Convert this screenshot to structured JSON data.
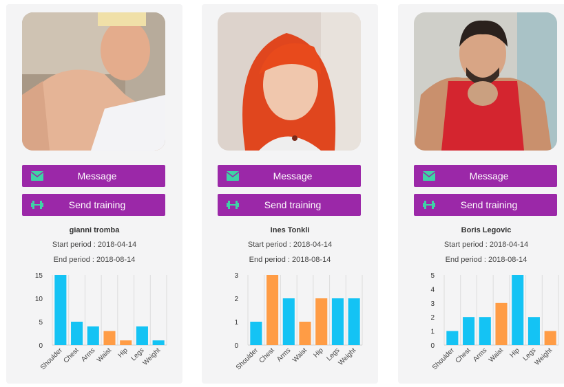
{
  "users": [
    {
      "name": "gianni tromba",
      "start_period": "Start period : 2018-04-14",
      "end_period": "End period : 2018-08-14",
      "message_label": "Message",
      "training_label": "Send training",
      "message_icon": "envelope-icon",
      "training_icon": "dumbbell-icon"
    },
    {
      "name": "Ines Tonkli",
      "start_period": "Start period : 2018-04-14",
      "end_period": "End period : 2018-08-14",
      "message_label": "Message",
      "training_label": "Send training",
      "message_icon": "envelope-icon",
      "training_icon": "dumbbell-icon"
    },
    {
      "name": "Boris Legovic",
      "start_period": "Start period : 2018-04-14",
      "end_period": "End period : 2018-08-14",
      "message_label": "Message",
      "training_label": "Send training",
      "message_icon": "envelope-icon",
      "training_icon": "dumbbell-icon"
    }
  ],
  "colors": {
    "button_bg": "#9b28a8",
    "icon_color": "#3fd3a6",
    "bar_blue": "#14c3f4",
    "bar_orange": "#ff9c45"
  },
  "chart_data": [
    {
      "type": "bar",
      "categories": [
        "Shoulder",
        "Chest",
        "Arms",
        "Waist",
        "Hip",
        "Legs",
        "Weight"
      ],
      "values": [
        15,
        5,
        4,
        3,
        1,
        4,
        1
      ],
      "bar_colors": [
        "blue",
        "blue",
        "blue",
        "orange",
        "orange",
        "blue",
        "blue"
      ],
      "yticks": [
        0,
        5,
        10,
        15
      ],
      "ylim": [
        0,
        15
      ]
    },
    {
      "type": "bar",
      "categories": [
        "Shoulder",
        "Chest",
        "Arms",
        "Waist",
        "Hip",
        "Legs",
        "Weight"
      ],
      "values": [
        1,
        3,
        2,
        1,
        2,
        2,
        2
      ],
      "bar_colors": [
        "blue",
        "orange",
        "blue",
        "orange",
        "orange",
        "blue",
        "blue"
      ],
      "yticks": [
        0,
        1,
        2,
        3
      ],
      "ylim": [
        0,
        3
      ]
    },
    {
      "type": "bar",
      "categories": [
        "Shoulder",
        "Chest",
        "Arms",
        "Waist",
        "Hip",
        "Legs",
        "Weight"
      ],
      "values": [
        1,
        2,
        2,
        3,
        5,
        2,
        1
      ],
      "bar_colors": [
        "blue",
        "blue",
        "blue",
        "orange",
        "blue",
        "blue",
        "orange"
      ],
      "yticks": [
        0,
        1,
        2,
        3,
        4,
        5
      ],
      "ylim": [
        0,
        5
      ]
    }
  ]
}
